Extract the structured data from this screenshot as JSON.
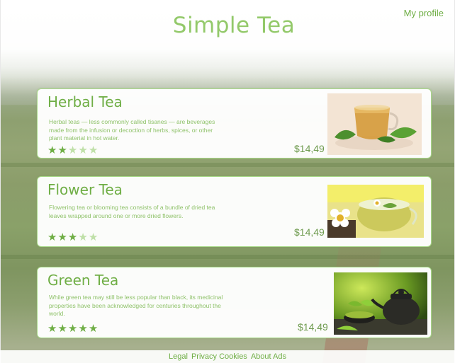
{
  "header": {
    "site_title": "Simple Tea",
    "profile_link": "My profile"
  },
  "products": [
    {
      "title": "Herbal Tea",
      "description": "Herbal teas — less commonly called tisanes — are beverages made from the infusion or decoction of herbs, spices, or other plant material in hot water.",
      "rating": 2,
      "rating_max": 5,
      "price": "$14,49",
      "image": "herbal-tea-cup-image"
    },
    {
      "title": "Flower Tea",
      "description": "Flowering tea or blooming tea consists of a bundle of dried tea leaves wrapped around one or more dried flowers.",
      "rating": 3,
      "rating_max": 5,
      "price": "$14,49",
      "image": "flower-tea-cup-image"
    },
    {
      "title": "Green Tea",
      "description": " While green tea may still be less popular than black, its medicinal properties have been acknowledged for centuries throughout the world.",
      "rating": 5,
      "rating_max": 5,
      "price": "$14,49",
      "image": "green-tea-teapot-image"
    }
  ],
  "footer": {
    "links": [
      "Legal",
      "Privacy Cookies",
      "About Ads"
    ]
  },
  "colors": {
    "accent": "#6fae45",
    "title": "#93c96a",
    "star_off": "#bfe0a8",
    "card_border": "#a9d98a"
  }
}
